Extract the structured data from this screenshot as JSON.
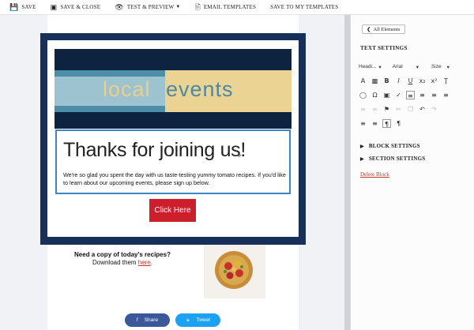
{
  "toolbar": {
    "items": [
      {
        "label": "SAVE",
        "icon": "floppy-disk-icon"
      },
      {
        "label": "SAVE & CLOSE",
        "icon": "save-close-icon"
      },
      {
        "label": "TEST & PREVIEW",
        "icon": "eye-icon"
      },
      {
        "label": "EMAIL TEMPLATES",
        "icon": "document-icon"
      },
      {
        "label": "SAVE TO MY TEMPLATES",
        "icon": ""
      }
    ]
  },
  "email": {
    "banner": {
      "word1": "local",
      "word2": "events"
    },
    "heading": "Thanks for joining us!",
    "body": "We're so glad you spent the day with us taste-testing yummy tomato recipes. If you'd like to learn about our upcoming events, please sign up below.",
    "cta_label": "Click Here",
    "recipe_line1": "Need a copy of today's recipes?",
    "recipe_line2_prefix": "Download them ",
    "recipe_link": "here",
    "recipe_line2_suffix": ".",
    "share_label": "Share",
    "tweet_label": "Tweet"
  },
  "panel": {
    "back_label": "All Elements",
    "text_settings": "TEXT SETTINGS",
    "style_select": "Headi...",
    "font_select": "Arial",
    "size_select": "Size",
    "block_settings": "BLOCK SETTINGS",
    "section_settings": "SECTION SETTINGS",
    "delete_label": "Delete Block"
  },
  "colors": {
    "modal_border": "#17305a",
    "cta": "#cc1e2b",
    "selection": "#3a87c8",
    "facebook": "#3b5998",
    "twitter": "#1da1f2"
  }
}
